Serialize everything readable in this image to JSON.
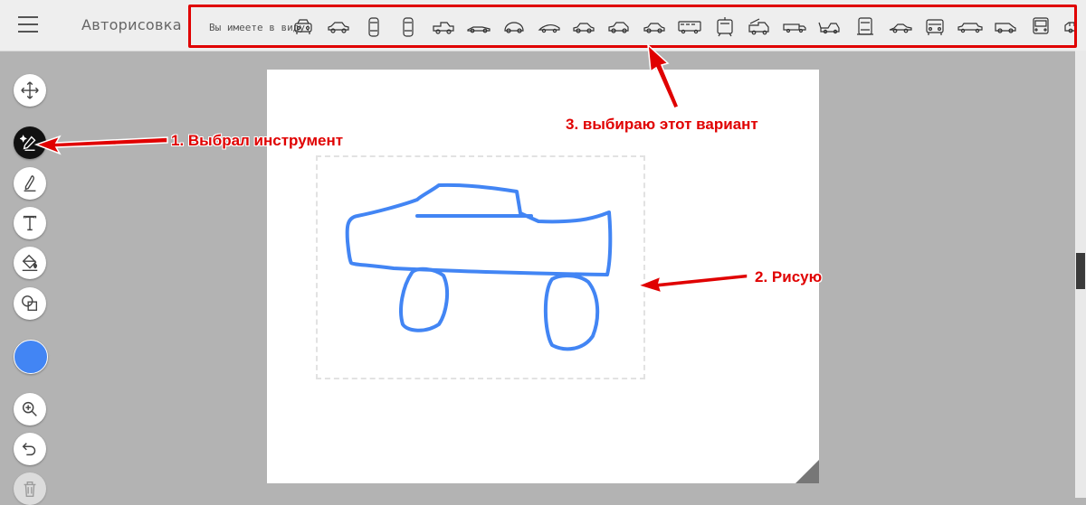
{
  "header": {
    "title": "Авторисовка",
    "suggestion_hint": "Вы имеете в виду:",
    "suggestions": [
      "car-front-icon",
      "car-side-icon",
      "car-top-icon",
      "car-top-icon",
      "pickup-icon",
      "race-car-icon",
      "beetle-icon",
      "coupe-icon",
      "sedan-icon",
      "hatchback-icon",
      "sedan-icon",
      "bus-icon",
      "tram-icon",
      "fire-truck-icon",
      "truck-icon",
      "tow-truck-icon",
      "semi-truck-icon",
      "sports-car-icon",
      "suv-icon",
      "limousine-icon",
      "van-icon",
      "bus-front-icon",
      "minivan-icon"
    ]
  },
  "tools": [
    {
      "name": "move-tool",
      "icon": "move-icon"
    },
    {
      "name": "autodraw-tool",
      "icon": "autodraw-icon"
    },
    {
      "name": "draw-tool",
      "icon": "pencil-icon"
    },
    {
      "name": "text-tool",
      "icon": "text-icon"
    },
    {
      "name": "fill-tool",
      "icon": "fill-bucket-icon"
    },
    {
      "name": "shape-tool",
      "icon": "shapes-icon"
    },
    {
      "name": "zoom-tool",
      "icon": "zoom-in-icon"
    },
    {
      "name": "undo-tool",
      "icon": "undo-icon"
    },
    {
      "name": "delete-tool",
      "icon": "trash-icon"
    }
  ],
  "selected_color": "#4285f4",
  "annotations": {
    "step1": "1. Выбрал инструмент",
    "step2": "2. Рисую",
    "step3": "3. выбираю этот вариант",
    "color": "#e00000"
  }
}
